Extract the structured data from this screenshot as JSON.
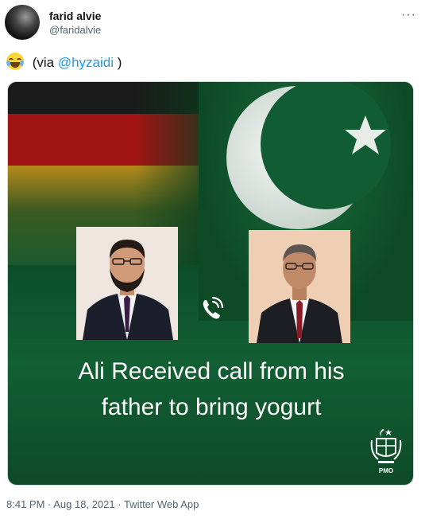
{
  "author": {
    "display_name": "farid alvie",
    "handle": "@faridalvie"
  },
  "menu": {
    "more_label": "···"
  },
  "tweet": {
    "emoji": "face-with-tears-of-joy",
    "prefix": " (via ",
    "mention": "@hyzaidi",
    "suffix": " )"
  },
  "media": {
    "caption_line1": "Ali Received call from his",
    "caption_line2": "father to bring yogurt",
    "emblem_label": "PMO",
    "flags": [
      "germany-flag",
      "pakistan-flag"
    ],
    "icon": "phone-call-icon"
  },
  "meta": {
    "time": "8:41 PM",
    "separator1": " · ",
    "date": "Aug 18, 2021",
    "separator2": " · ",
    "source": "Twitter Web App"
  },
  "colors": {
    "link": "#1d9bf0",
    "secondary_text": "#536471",
    "pakistan_green": "#0c4a26"
  }
}
